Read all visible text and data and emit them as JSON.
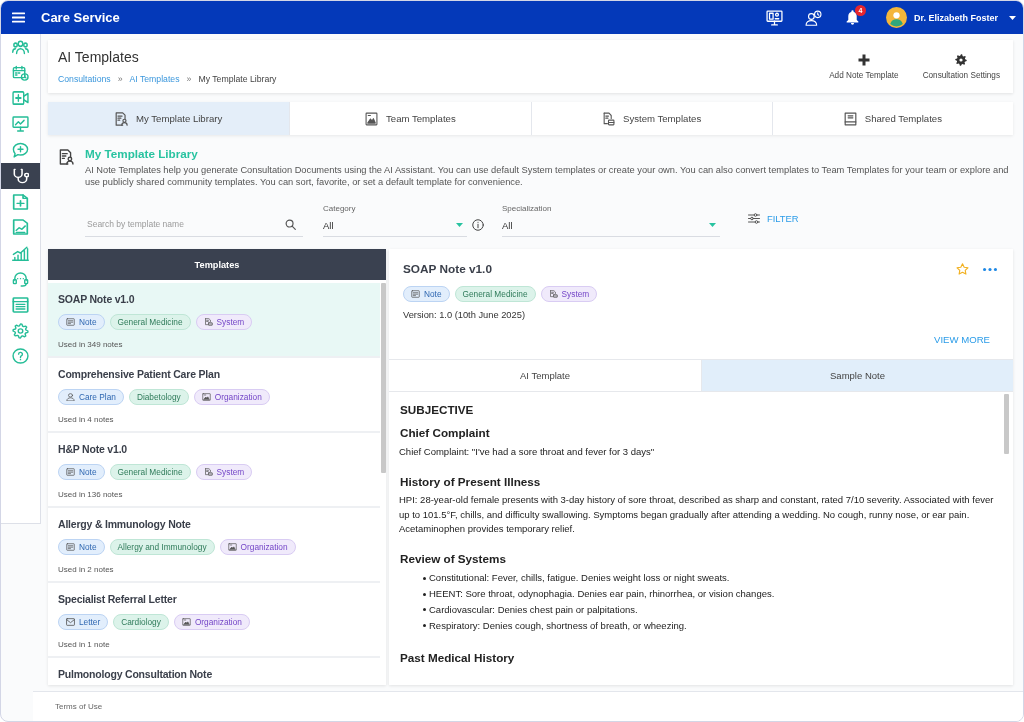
{
  "top_bar": {
    "title": "Care Service",
    "notifications": "4",
    "user_name": "Dr. Elizabeth Foster"
  },
  "sidebar": {
    "items": [
      {
        "kind": "team",
        "selected": false
      },
      {
        "kind": "calendar",
        "selected": false
      },
      {
        "kind": "video",
        "selected": false
      },
      {
        "kind": "monitor",
        "selected": false
      },
      {
        "kind": "chat",
        "selected": false
      },
      {
        "kind": "stethoscope",
        "selected": true
      },
      {
        "kind": "prescription",
        "selected": false
      },
      {
        "kind": "report",
        "selected": false
      },
      {
        "kind": "analytics",
        "selected": false
      },
      {
        "kind": "support",
        "selected": false
      },
      {
        "kind": "ledger",
        "selected": false
      },
      {
        "kind": "settings",
        "selected": false
      },
      {
        "kind": "help",
        "selected": false
      }
    ]
  },
  "page_header": {
    "title": "AI Templates",
    "breadcrumbs": {
      "separator": "»",
      "items": [
        {
          "label": "Consultations",
          "kind": "link"
        },
        {
          "label": "AI Templates",
          "kind": "link"
        },
        {
          "label": "My Template Library",
          "kind": "current"
        }
      ]
    },
    "actions": [
      {
        "label": "Add Note Template",
        "kind": "add"
      },
      {
        "label": "Consultation Settings",
        "kind": "settings"
      }
    ]
  },
  "tabs": [
    {
      "label": "My Template Library",
      "kind": "personal",
      "selected": true
    },
    {
      "label": "Team Templates",
      "kind": "team",
      "selected": false
    },
    {
      "label": "System Templates",
      "kind": "system",
      "selected": false
    },
    {
      "label": "Shared Templates",
      "kind": "shared",
      "selected": false
    }
  ],
  "section": {
    "title": "My Template Library",
    "description": "AI Note Templates help you generate Consultation Documents using the AI Assistant. You can use default System templates or create your own. You can also convert templates to Team Templates for your team or explore and use publicly shared community templates. You can sort, favorite, or set a default template for convenience."
  },
  "filters": {
    "search": {
      "placeholder": "Search by template name"
    },
    "category": {
      "label": "Category",
      "value": "All"
    },
    "specialization": {
      "label": "Specialization",
      "value": "All"
    },
    "filter_button": "FILTER"
  },
  "templates": {
    "header": "Templates",
    "items": [
      {
        "title": "SOAP Note v1.0",
        "selected": true,
        "tags": [
          {
            "label": "Note",
            "kind": "note"
          },
          {
            "label": "General Medicine",
            "kind": "specialty"
          },
          {
            "label": "System",
            "kind": "system"
          }
        ],
        "usage": "Used in 349 notes"
      },
      {
        "title": "Comprehensive Patient Care Plan",
        "selected": false,
        "tags": [
          {
            "label": "Care Plan",
            "kind": "care_plan"
          },
          {
            "label": "Diabetology",
            "kind": "specialty"
          },
          {
            "label": "Organization",
            "kind": "organization"
          }
        ],
        "usage": "Used in 4 notes"
      },
      {
        "title": "H&P Note v1.0",
        "selected": false,
        "tags": [
          {
            "label": "Note",
            "kind": "note"
          },
          {
            "label": "General Medicine",
            "kind": "specialty"
          },
          {
            "label": "System",
            "kind": "system"
          }
        ],
        "usage": "Used in 136 notes"
      },
      {
        "title": "Allergy & Immunology Note",
        "selected": false,
        "tags": [
          {
            "label": "Note",
            "kind": "note"
          },
          {
            "label": "Allergy and Immunology",
            "kind": "specialty"
          },
          {
            "label": "Organization",
            "kind": "organization"
          }
        ],
        "usage": "Used in 2 notes"
      },
      {
        "title": "Specialist Referral Letter",
        "selected": false,
        "tags": [
          {
            "label": "Letter",
            "kind": "letter"
          },
          {
            "label": "Cardiology",
            "kind": "specialty"
          },
          {
            "label": "Organization",
            "kind": "organization"
          }
        ],
        "usage": "Used in 1 note"
      },
      {
        "title": "Pulmonology Consultation Note",
        "selected": false
      }
    ]
  },
  "detail": {
    "title": "SOAP Note v1.0",
    "favorite": false,
    "tags": [
      {
        "label": "Note",
        "kind": "note"
      },
      {
        "label": "General Medicine",
        "kind": "specialty"
      },
      {
        "label": "System",
        "kind": "system"
      }
    ],
    "version": "Version: 1.0 (10th June 2025)",
    "view_more": "VIEW MORE",
    "tabs": [
      {
        "label": "AI Template",
        "selected": false
      },
      {
        "label": "Sample Note",
        "selected": true
      }
    ],
    "content": [
      {
        "kind": "section",
        "text": "SUBJECTIVE"
      },
      {
        "kind": "heading",
        "text": "Chief Complaint"
      },
      {
        "kind": "paragraph",
        "text": "Chief Complaint: \"I've had a sore throat and fever for 3 days\""
      },
      {
        "kind": "heading",
        "text": "History of Present Illness"
      },
      {
        "kind": "paragraph",
        "text": "HPI: 28-year-old female presents with 3-day history of sore throat, described as sharp and constant, rated 7/10 severity. Associated with fever up to 101.5°F, chills, and difficulty swallowing. Symptoms began gradually after attending a wedding. No cough, runny nose, or ear pain. Acetaminophen provides temporary relief."
      },
      {
        "kind": "heading",
        "text": "Review of Systems"
      },
      {
        "kind": "bullets",
        "items": [
          "Constitutional: Fever, chills, fatigue. Denies weight loss or night sweats.",
          "HEENT: Sore throat, odynophagia. Denies ear pain, rhinorrhea, or vision changes.",
          "Cardiovascular: Denies chest pain or palpitations.",
          "Respiratory: Denies cough, shortness of breath, or wheezing."
        ]
      },
      {
        "kind": "heading",
        "text": "Past Medical History"
      }
    ]
  },
  "footer": {
    "link": "Terms of Use"
  }
}
